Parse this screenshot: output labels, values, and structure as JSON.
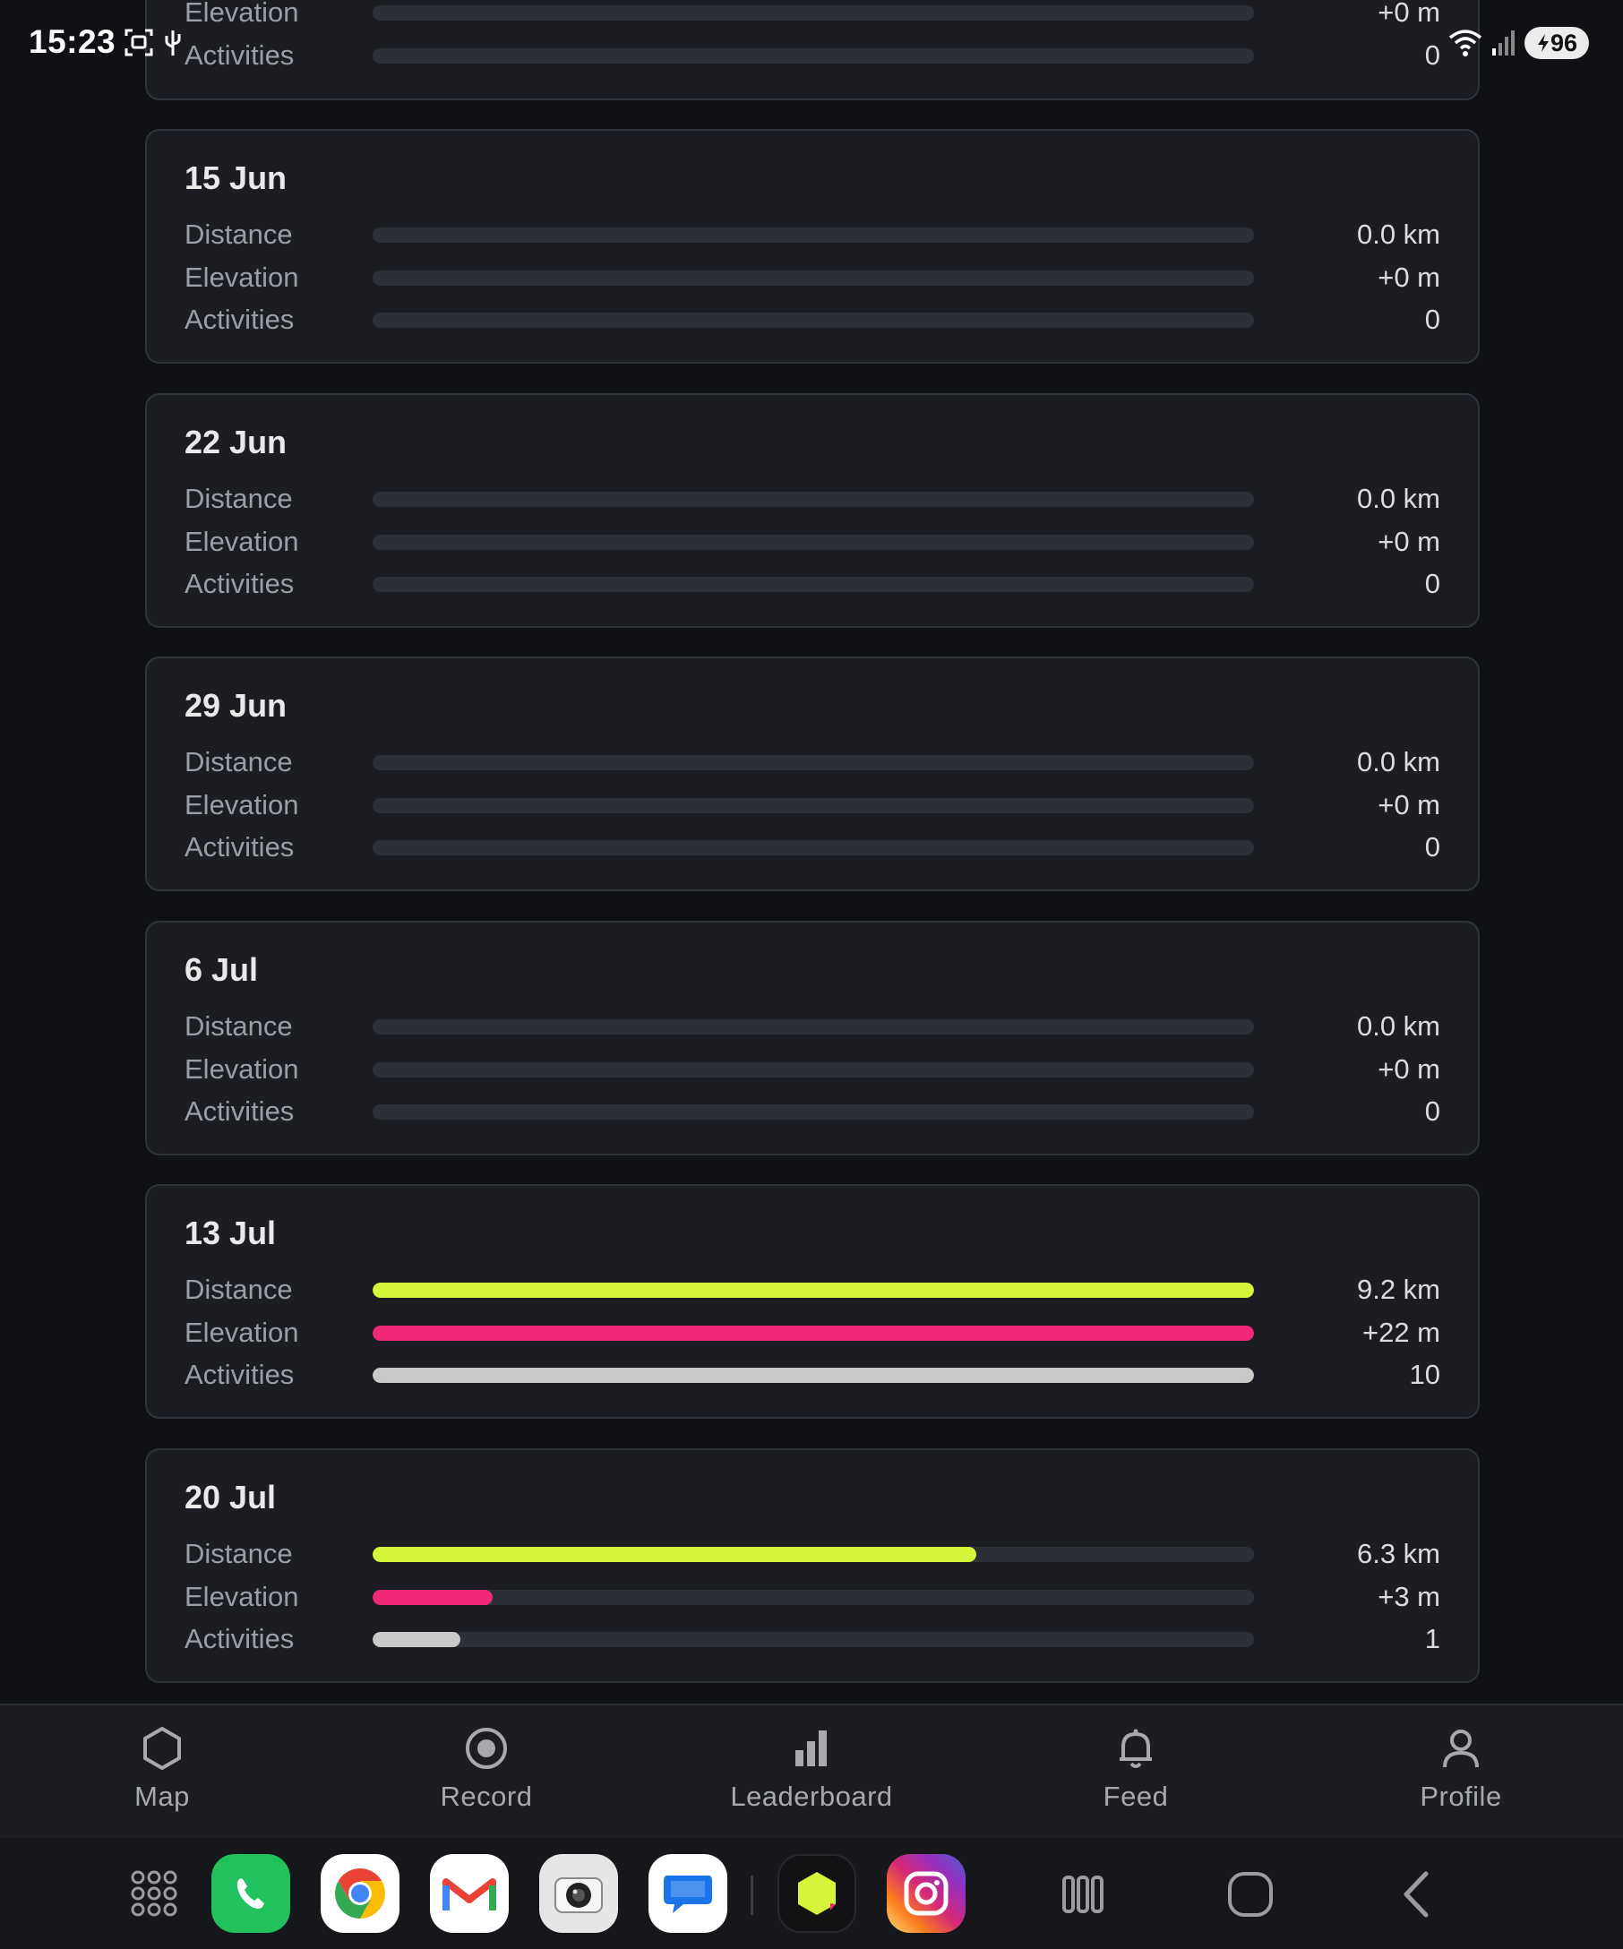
{
  "status_bar": {
    "time": "15:23",
    "battery": "96"
  },
  "weeks": [
    {
      "date": "",
      "stats": [
        {
          "label": "Elevation",
          "value": "+0 m",
          "fill": 0
        },
        {
          "label": "Activities",
          "value": "0",
          "fill": 0
        }
      ]
    },
    {
      "date": "15 Jun",
      "stats": [
        {
          "label": "Distance",
          "value": "0.0 km",
          "fill": 0
        },
        {
          "label": "Elevation",
          "value": "+0 m",
          "fill": 0
        },
        {
          "label": "Activities",
          "value": "0",
          "fill": 0
        }
      ]
    },
    {
      "date": "22 Jun",
      "stats": [
        {
          "label": "Distance",
          "value": "0.0 km",
          "fill": 0
        },
        {
          "label": "Elevation",
          "value": "+0 m",
          "fill": 0
        },
        {
          "label": "Activities",
          "value": "0",
          "fill": 0
        }
      ]
    },
    {
      "date": "29 Jun",
      "stats": [
        {
          "label": "Distance",
          "value": "0.0 km",
          "fill": 0
        },
        {
          "label": "Elevation",
          "value": "+0 m",
          "fill": 0
        },
        {
          "label": "Activities",
          "value": "0",
          "fill": 0
        }
      ]
    },
    {
      "date": "6 Jul",
      "stats": [
        {
          "label": "Distance",
          "value": "0.0 km",
          "fill": 0
        },
        {
          "label": "Elevation",
          "value": "+0 m",
          "fill": 0
        },
        {
          "label": "Activities",
          "value": "0",
          "fill": 0
        }
      ]
    },
    {
      "date": "13 Jul",
      "stats": [
        {
          "label": "Distance",
          "value": "9.2 km",
          "fill": 1.0
        },
        {
          "label": "Elevation",
          "value": "+22 m",
          "fill": 1.0
        },
        {
          "label": "Activities",
          "value": "10",
          "fill": 1.0
        }
      ]
    },
    {
      "date": "20 Jul",
      "stats": [
        {
          "label": "Distance",
          "value": "6.3 km",
          "fill": 0.685
        },
        {
          "label": "Elevation",
          "value": "+3 m",
          "fill": 0.136
        },
        {
          "label": "Activities",
          "value": "1",
          "fill": 0.1
        }
      ]
    }
  ],
  "colors": {
    "distance": "#d4f53a",
    "elevation": "#f0287a",
    "activities": "#c9c9c9"
  },
  "nav": [
    {
      "label": "Map",
      "icon": "hexagon-icon"
    },
    {
      "label": "Record",
      "icon": "record-icon"
    },
    {
      "label": "Leaderboard",
      "icon": "bar-chart-icon"
    },
    {
      "label": "Feed",
      "icon": "bell-icon"
    },
    {
      "label": "Profile",
      "icon": "user-icon"
    }
  ],
  "dock": {
    "apps": [
      "apps-grid-icon",
      "phone-icon",
      "chrome-icon",
      "gmail-icon",
      "camera-icon",
      "messages-icon",
      "hexagon-app-icon",
      "instagram-icon"
    ],
    "system": [
      "recents-icon",
      "home-icon",
      "back-icon"
    ]
  }
}
